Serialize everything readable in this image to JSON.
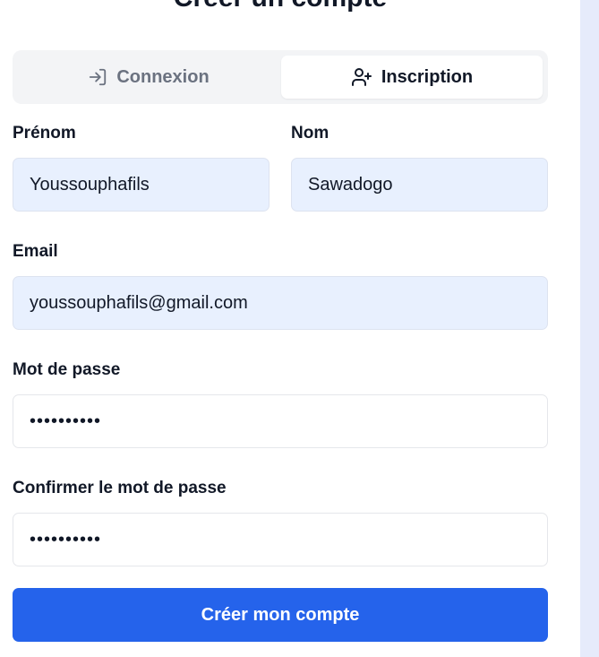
{
  "form": {
    "title": "Créer un compte",
    "tabs": [
      {
        "label": "Connexion",
        "icon": "login-icon",
        "active": false
      },
      {
        "label": "Inscription",
        "icon": "user-plus-icon",
        "active": true
      }
    ],
    "first_name": {
      "label": "Prénom",
      "value": "Youssouphafils"
    },
    "last_name": {
      "label": "Nom",
      "value": "Sawadogo"
    },
    "email": {
      "label": "Email",
      "value": "youssouphafils@gmail.com"
    },
    "password": {
      "label": "Mot de passe",
      "value": "••••••••••"
    },
    "confirm_password": {
      "label": "Confirmer le mot de passe",
      "value": "••••••••••"
    },
    "submit_label": "Créer mon compte"
  },
  "colors": {
    "accent": "#2563eb",
    "autofill_bg": "#e8f0fe",
    "tab_bg": "#f3f4f6"
  }
}
